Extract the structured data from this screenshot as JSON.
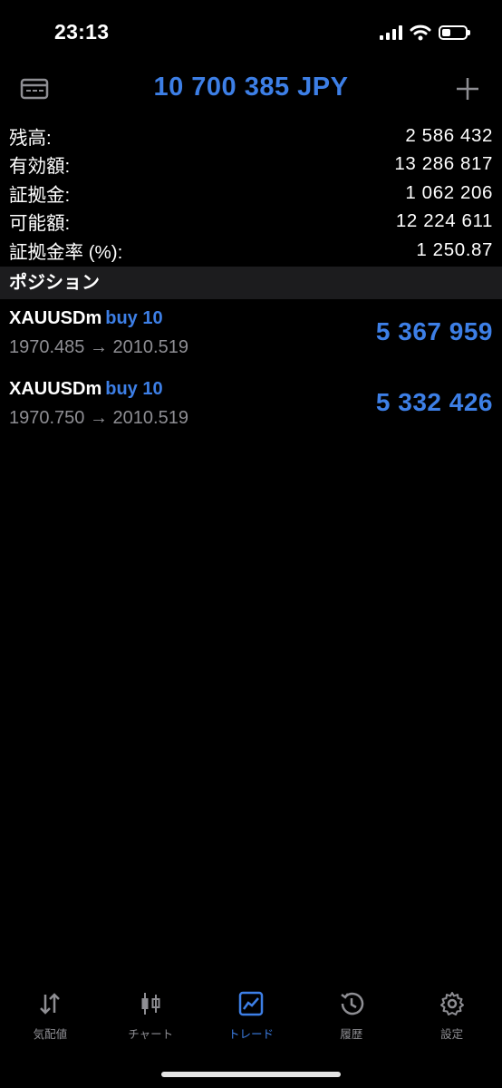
{
  "status_bar": {
    "time": "23:13",
    "icons": [
      "signal-icon",
      "wifi-icon",
      "battery-icon"
    ]
  },
  "header": {
    "title": "10 700 385 JPY",
    "left_icon": "account-card-icon",
    "right_icon": "plus-icon",
    "accent_color": "#3d7fe6"
  },
  "summary": [
    {
      "label": "残高:",
      "value": "2 586 432"
    },
    {
      "label": "有効額:",
      "value": "13 286 817"
    },
    {
      "label": "証拠金:",
      "value": "1 062 206"
    },
    {
      "label": "可能額:",
      "value": "12 224 611"
    },
    {
      "label": "証拠金率 (%):",
      "value": "1 250.87"
    }
  ],
  "positions_section": {
    "title": "ポジション",
    "items": [
      {
        "symbol": "XAUUSDm",
        "side": "buy 10",
        "prices": "1970.485 → 2010.519",
        "profit": "5 367 959"
      },
      {
        "symbol": "XAUUSDm",
        "side": "buy 10",
        "prices": "1970.750 → 2010.519",
        "profit": "5 332 426"
      }
    ]
  },
  "tabs": [
    {
      "label": "気配値",
      "icon": "quotes-arrows-icon",
      "active": false
    },
    {
      "label": "チャート",
      "icon": "candlestick-chart-icon",
      "active": false
    },
    {
      "label": "トレード",
      "icon": "trade-chart-icon",
      "active": true
    },
    {
      "label": "履歴",
      "icon": "history-clock-icon",
      "active": false
    },
    {
      "label": "設定",
      "icon": "settings-gear-icon",
      "active": false
    }
  ]
}
